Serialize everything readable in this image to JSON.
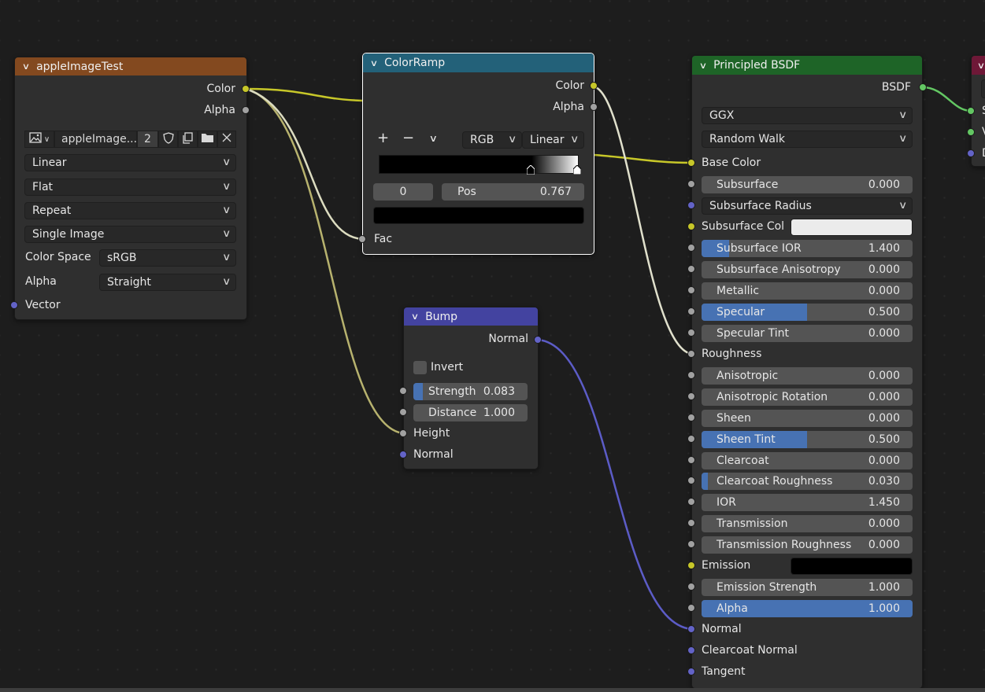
{
  "colors": {
    "background": "#1d1d1d",
    "node_body": "#2f2f2f",
    "image_header": "#83491f",
    "colorramp_header": "#236179",
    "bump_header": "#4343a0",
    "principled_header": "#1e6427",
    "output_header": "#6e1837",
    "slider_fill": "#4772b3",
    "socket_color": "#c7c729",
    "socket_float": "#a1a1a1",
    "socket_vector": "#6363c7",
    "socket_shader": "#63c763"
  },
  "image_node": {
    "title": "appleImageTest",
    "outputs": {
      "color": "Color",
      "alpha": "Alpha"
    },
    "image_name": "appleImage...",
    "users": "2",
    "interpolation": "Linear",
    "projection": "Flat",
    "extension": "Repeat",
    "source": "Single Image",
    "color_space_label": "Color Space",
    "color_space_value": "sRGB",
    "alpha_label": "Alpha",
    "alpha_value": "Straight",
    "vector_label": "Vector"
  },
  "colorramp_node": {
    "title": "ColorRamp",
    "outputs": {
      "color": "Color",
      "alpha": "Alpha"
    },
    "add_glyph": "+",
    "remove_glyph": "−",
    "color_mode": "RGB",
    "interpolation": "Linear",
    "active_index": "0",
    "pos_label": "Pos",
    "pos_value": "0.767",
    "fac_label": "Fac"
  },
  "bump_node": {
    "title": "Bump",
    "output_normal": "Normal",
    "invert_label": "Invert",
    "invert_checked": false,
    "strength_label": "Strength",
    "strength_value": "0.083",
    "strength_fraction": 0.083,
    "distance_label": "Distance",
    "distance_value": "1.000",
    "height_label": "Height",
    "normal_label": "Normal"
  },
  "principled_node": {
    "title": "Principled BSDF",
    "output_bsdf": "BSDF",
    "distribution": "GGX",
    "subsurface_method": "Random Walk",
    "base_color_label": "Base Color",
    "subsurface": {
      "label": "Subsurface",
      "value": "0.000",
      "fraction": 0
    },
    "subsurface_radius": "Subsurface Radius",
    "subsurface_col_label": "Subsurface Col",
    "subsurface_col_color": "#ebebeb",
    "subsurface_ior": {
      "label": "Subsurface IOR",
      "value": "1.400",
      "fraction": 0.13
    },
    "subsurface_anisotropy": {
      "label": "Subsurface Anisotropy",
      "value": "0.000",
      "fraction": 0
    },
    "metallic": {
      "label": "Metallic",
      "value": "0.000",
      "fraction": 0
    },
    "specular": {
      "label": "Specular",
      "value": "0.500",
      "fraction": 0.5
    },
    "specular_tint": {
      "label": "Specular Tint",
      "value": "0.000",
      "fraction": 0
    },
    "roughness_label": "Roughness",
    "anisotropic": {
      "label": "Anisotropic",
      "value": "0.000",
      "fraction": 0
    },
    "anisotropic_rotation": {
      "label": "Anisotropic Rotation",
      "value": "0.000",
      "fraction": 0
    },
    "sheen": {
      "label": "Sheen",
      "value": "0.000",
      "fraction": 0
    },
    "sheen_tint": {
      "label": "Sheen Tint",
      "value": "0.500",
      "fraction": 0.5
    },
    "clearcoat": {
      "label": "Clearcoat",
      "value": "0.000",
      "fraction": 0
    },
    "clearcoat_roughness": {
      "label": "Clearcoat Roughness",
      "value": "0.030",
      "fraction": 0.03
    },
    "ior": {
      "label": "IOR",
      "value": "1.450",
      "fraction": 0
    },
    "transmission": {
      "label": "Transmission",
      "value": "0.000",
      "fraction": 0
    },
    "transmission_roughness": {
      "label": "Transmission Roughness",
      "value": "0.000",
      "fraction": 0
    },
    "emission_label": "Emission",
    "emission_color": "#000000",
    "emission_strength": {
      "label": "Emission Strength",
      "value": "1.000",
      "fraction": 0
    },
    "alpha": {
      "label": "Alpha",
      "value": "1.000",
      "fraction": 1.0
    },
    "normal_label": "Normal",
    "clearcoat_normal_label": "Clearcoat Normal",
    "tangent_label": "Tangent"
  },
  "output_node": {
    "input_1": "S",
    "input_2": "V",
    "input_3": "D"
  }
}
